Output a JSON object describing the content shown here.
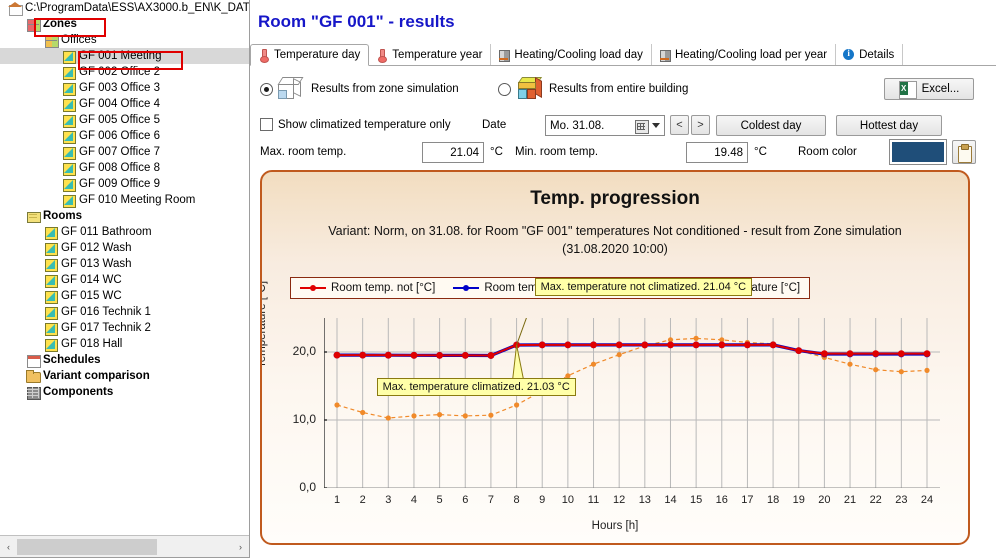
{
  "sidebar": {
    "tree": [
      {
        "label": "C:\\ProgramData\\ESS\\AX3000.b_EN\\K_DAT",
        "indent": 0,
        "icon": "house-icon",
        "bold": false,
        "selected": false
      },
      {
        "label": "Zones",
        "indent": 1,
        "icon": "zones-icon",
        "bold": true,
        "selected": false
      },
      {
        "label": "Offices",
        "indent": 2,
        "icon": "offices-icon",
        "bold": false,
        "selected": false
      },
      {
        "label": "GF 001 Meeting",
        "indent": 3,
        "icon": "room-icon",
        "bold": false,
        "selected": true
      },
      {
        "label": "GF 002 Office 2",
        "indent": 3,
        "icon": "room-icon",
        "bold": false,
        "selected": false
      },
      {
        "label": "GF 003 Office 3",
        "indent": 3,
        "icon": "room-icon",
        "bold": false,
        "selected": false
      },
      {
        "label": "GF 004 Office 4",
        "indent": 3,
        "icon": "room-icon",
        "bold": false,
        "selected": false
      },
      {
        "label": "GF 005 Office 5",
        "indent": 3,
        "icon": "room-icon",
        "bold": false,
        "selected": false
      },
      {
        "label": "GF 006 Office 6",
        "indent": 3,
        "icon": "room-icon",
        "bold": false,
        "selected": false
      },
      {
        "label": "GF 007 Office 7",
        "indent": 3,
        "icon": "room-icon",
        "bold": false,
        "selected": false
      },
      {
        "label": "GF 008 Office 8",
        "indent": 3,
        "icon": "room-icon",
        "bold": false,
        "selected": false
      },
      {
        "label": "GF 009 Office 9",
        "indent": 3,
        "icon": "room-icon",
        "bold": false,
        "selected": false
      },
      {
        "label": "GF 010 Meeting Room",
        "indent": 3,
        "icon": "room-icon",
        "bold": false,
        "selected": false
      },
      {
        "label": "Rooms",
        "indent": 1,
        "icon": "rooms-icon",
        "bold": true,
        "selected": false
      },
      {
        "label": "GF 011 Bathroom",
        "indent": 2,
        "icon": "room-icon",
        "bold": false,
        "selected": false
      },
      {
        "label": "GF 012 Wash",
        "indent": 2,
        "icon": "room-icon",
        "bold": false,
        "selected": false
      },
      {
        "label": "GF 013 Wash",
        "indent": 2,
        "icon": "room-icon",
        "bold": false,
        "selected": false
      },
      {
        "label": "GF 014 WC",
        "indent": 2,
        "icon": "room-icon",
        "bold": false,
        "selected": false
      },
      {
        "label": "GF 015 WC",
        "indent": 2,
        "icon": "room-icon",
        "bold": false,
        "selected": false
      },
      {
        "label": "GF 016 Technik 1",
        "indent": 2,
        "icon": "room-icon",
        "bold": false,
        "selected": false
      },
      {
        "label": "GF 017 Technik 2",
        "indent": 2,
        "icon": "room-icon",
        "bold": false,
        "selected": false
      },
      {
        "label": "GF 018 Hall",
        "indent": 2,
        "icon": "room-icon",
        "bold": false,
        "selected": false
      },
      {
        "label": "Schedules",
        "indent": 1,
        "icon": "calendar-icon",
        "bold": true,
        "selected": false
      },
      {
        "label": "Variant comparison",
        "indent": 1,
        "icon": "folder-icon",
        "bold": true,
        "selected": false
      },
      {
        "label": "Components",
        "indent": 1,
        "icon": "brick-icon",
        "bold": true,
        "selected": false
      }
    ],
    "highlight_color": "#e00000",
    "scroll_left_arrow": "‹",
    "scroll_right_arrow": "›"
  },
  "header": {
    "title": "Room \"GF 001\" - results",
    "title_color": "#1616c8"
  },
  "tabs": [
    {
      "label": "Temperature day",
      "icon": "thermometer-icon",
      "active": true
    },
    {
      "label": "Temperature year",
      "icon": "thermometer-icon",
      "active": false
    },
    {
      "label": "Heating/Cooling load day",
      "icon": "load-icon",
      "active": false
    },
    {
      "label": "Heating/Cooling load per year",
      "icon": "load-icon",
      "active": false
    },
    {
      "label": "Details",
      "icon": "info-icon",
      "active": false
    }
  ],
  "controls": {
    "source_zone_label": "Results from zone simulation",
    "source_zone_selected": true,
    "source_building_label": "Results from entire building",
    "source_building_selected": false,
    "excel_label": "Excel...",
    "climatized_only_label": "Show climatized temperature only",
    "climatized_only_checked": false,
    "date_label": "Date",
    "date_value": "Mo. 31.08.",
    "prev_label": "<",
    "next_label": ">",
    "coldest_day_label": "Coldest day",
    "hottest_day_label": "Hottest day",
    "max_room_temp_label": "Max. room temp.",
    "max_room_temp_value": "21.04",
    "max_unit": "°C",
    "min_room_temp_label": "Min. room temp.",
    "min_room_temp_value": "19.48",
    "min_unit": "°C",
    "room_color_label": "Room color",
    "room_color_value": "#1f4e79"
  },
  "chart_data": {
    "type": "line",
    "title": "Temp. progression",
    "subtitle_line1": "Variant: Norm, on 31.08. for Room \"GF 001\" temperatures Not conditioned - result from Zone simulation",
    "subtitle_line2": "(31.08.2020 10:00)",
    "xlabel": "Hours [h]",
    "ylabel": "Temperature [°C]",
    "xlim": [
      1,
      24
    ],
    "ylim": [
      0,
      25
    ],
    "ytick_labels": [
      "0,0",
      "10,0",
      "20,0"
    ],
    "ytick_values": [
      0,
      10,
      20
    ],
    "grid": true,
    "legend_position": "top-left",
    "x": [
      1,
      2,
      3,
      4,
      5,
      6,
      7,
      8,
      9,
      10,
      11,
      12,
      13,
      14,
      15,
      16,
      17,
      18,
      19,
      20,
      21,
      22,
      23,
      24
    ],
    "series": [
      {
        "name": "Room temp. not  [°C]",
        "color": "#e00000",
        "style": "solid",
        "values": [
          19.55,
          19.55,
          19.53,
          19.52,
          19.5,
          19.5,
          19.48,
          21.03,
          21.04,
          21.04,
          21.04,
          21.04,
          21.04,
          21.04,
          21.04,
          21.04,
          21.04,
          21.04,
          20.2,
          19.77,
          19.77,
          19.77,
          19.77,
          19.77
        ]
      },
      {
        "name": "Room temp. climatized [°C]",
        "color": "#0000c8",
        "style": "solid",
        "values": [
          19.55,
          19.55,
          19.53,
          19.52,
          19.5,
          19.5,
          19.48,
          21.03,
          21.04,
          21.04,
          21.04,
          21.04,
          21.04,
          21.04,
          21.04,
          21.04,
          21.04,
          21.04,
          20.2,
          19.7,
          19.7,
          19.7,
          19.7,
          19.7
        ]
      },
      {
        "name": "Exterior temperature [°C]",
        "color": "#f08a2a",
        "style": "dashed",
        "values": [
          12.2,
          11.1,
          10.3,
          10.6,
          10.8,
          10.6,
          10.7,
          12.2,
          14.3,
          16.5,
          18.2,
          19.6,
          20.9,
          21.8,
          22.0,
          21.8,
          21.4,
          21.2,
          20.2,
          19.2,
          18.2,
          17.4,
          17.1,
          17.3
        ]
      }
    ],
    "annotations": [
      {
        "text": "Max. temperature not climatized. 21.04 °C",
        "point_x": 8,
        "point_y": 21.04
      },
      {
        "text": "Max. temperature climatized. 21.03 °C",
        "point_x": 8,
        "point_y": 21.03
      }
    ]
  }
}
